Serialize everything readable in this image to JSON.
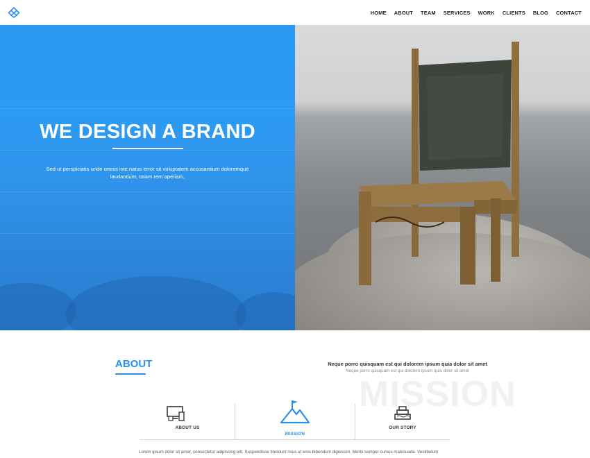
{
  "nav": {
    "items": [
      "HOME",
      "ABOUT",
      "TEAM",
      "SERVICES",
      "WORK",
      "CLIENTS",
      "BLOG",
      "CONTACT"
    ]
  },
  "hero": {
    "title": "WE DESIGN A BRAND",
    "subtitle": "Sed ut perspiciatis unde omnis iste natus error sit voluptatem accusantium doloremque laudantium, totam rem aperiam,"
  },
  "about": {
    "title": "ABOUT",
    "mission_heading": "Neque porro quisquam est qui dolorem ipsum quia dolor sit amet",
    "mission_subheading": "Neque porro quisquam est qui dolorem ipsum quia dolor sit amet",
    "mission_background_word": "MISSION",
    "tabs": [
      {
        "label": "ABOUT US",
        "icon": "monitor-devices-icon"
      },
      {
        "label": "MISSION",
        "icon": "mountain-flag-icon"
      },
      {
        "label": "OUR STORY",
        "icon": "cake-icon"
      }
    ],
    "body_text": "Lorem ipsum dolor sit amet, consectetur adipiscing elit. Suspendisse tincidunt risus ut eros bibendum dignissim. Morbi semper cursus malesuada. Vestibulum"
  },
  "colors": {
    "accent": "#2b8ff0",
    "hero_blue": "#2d9bf3"
  }
}
